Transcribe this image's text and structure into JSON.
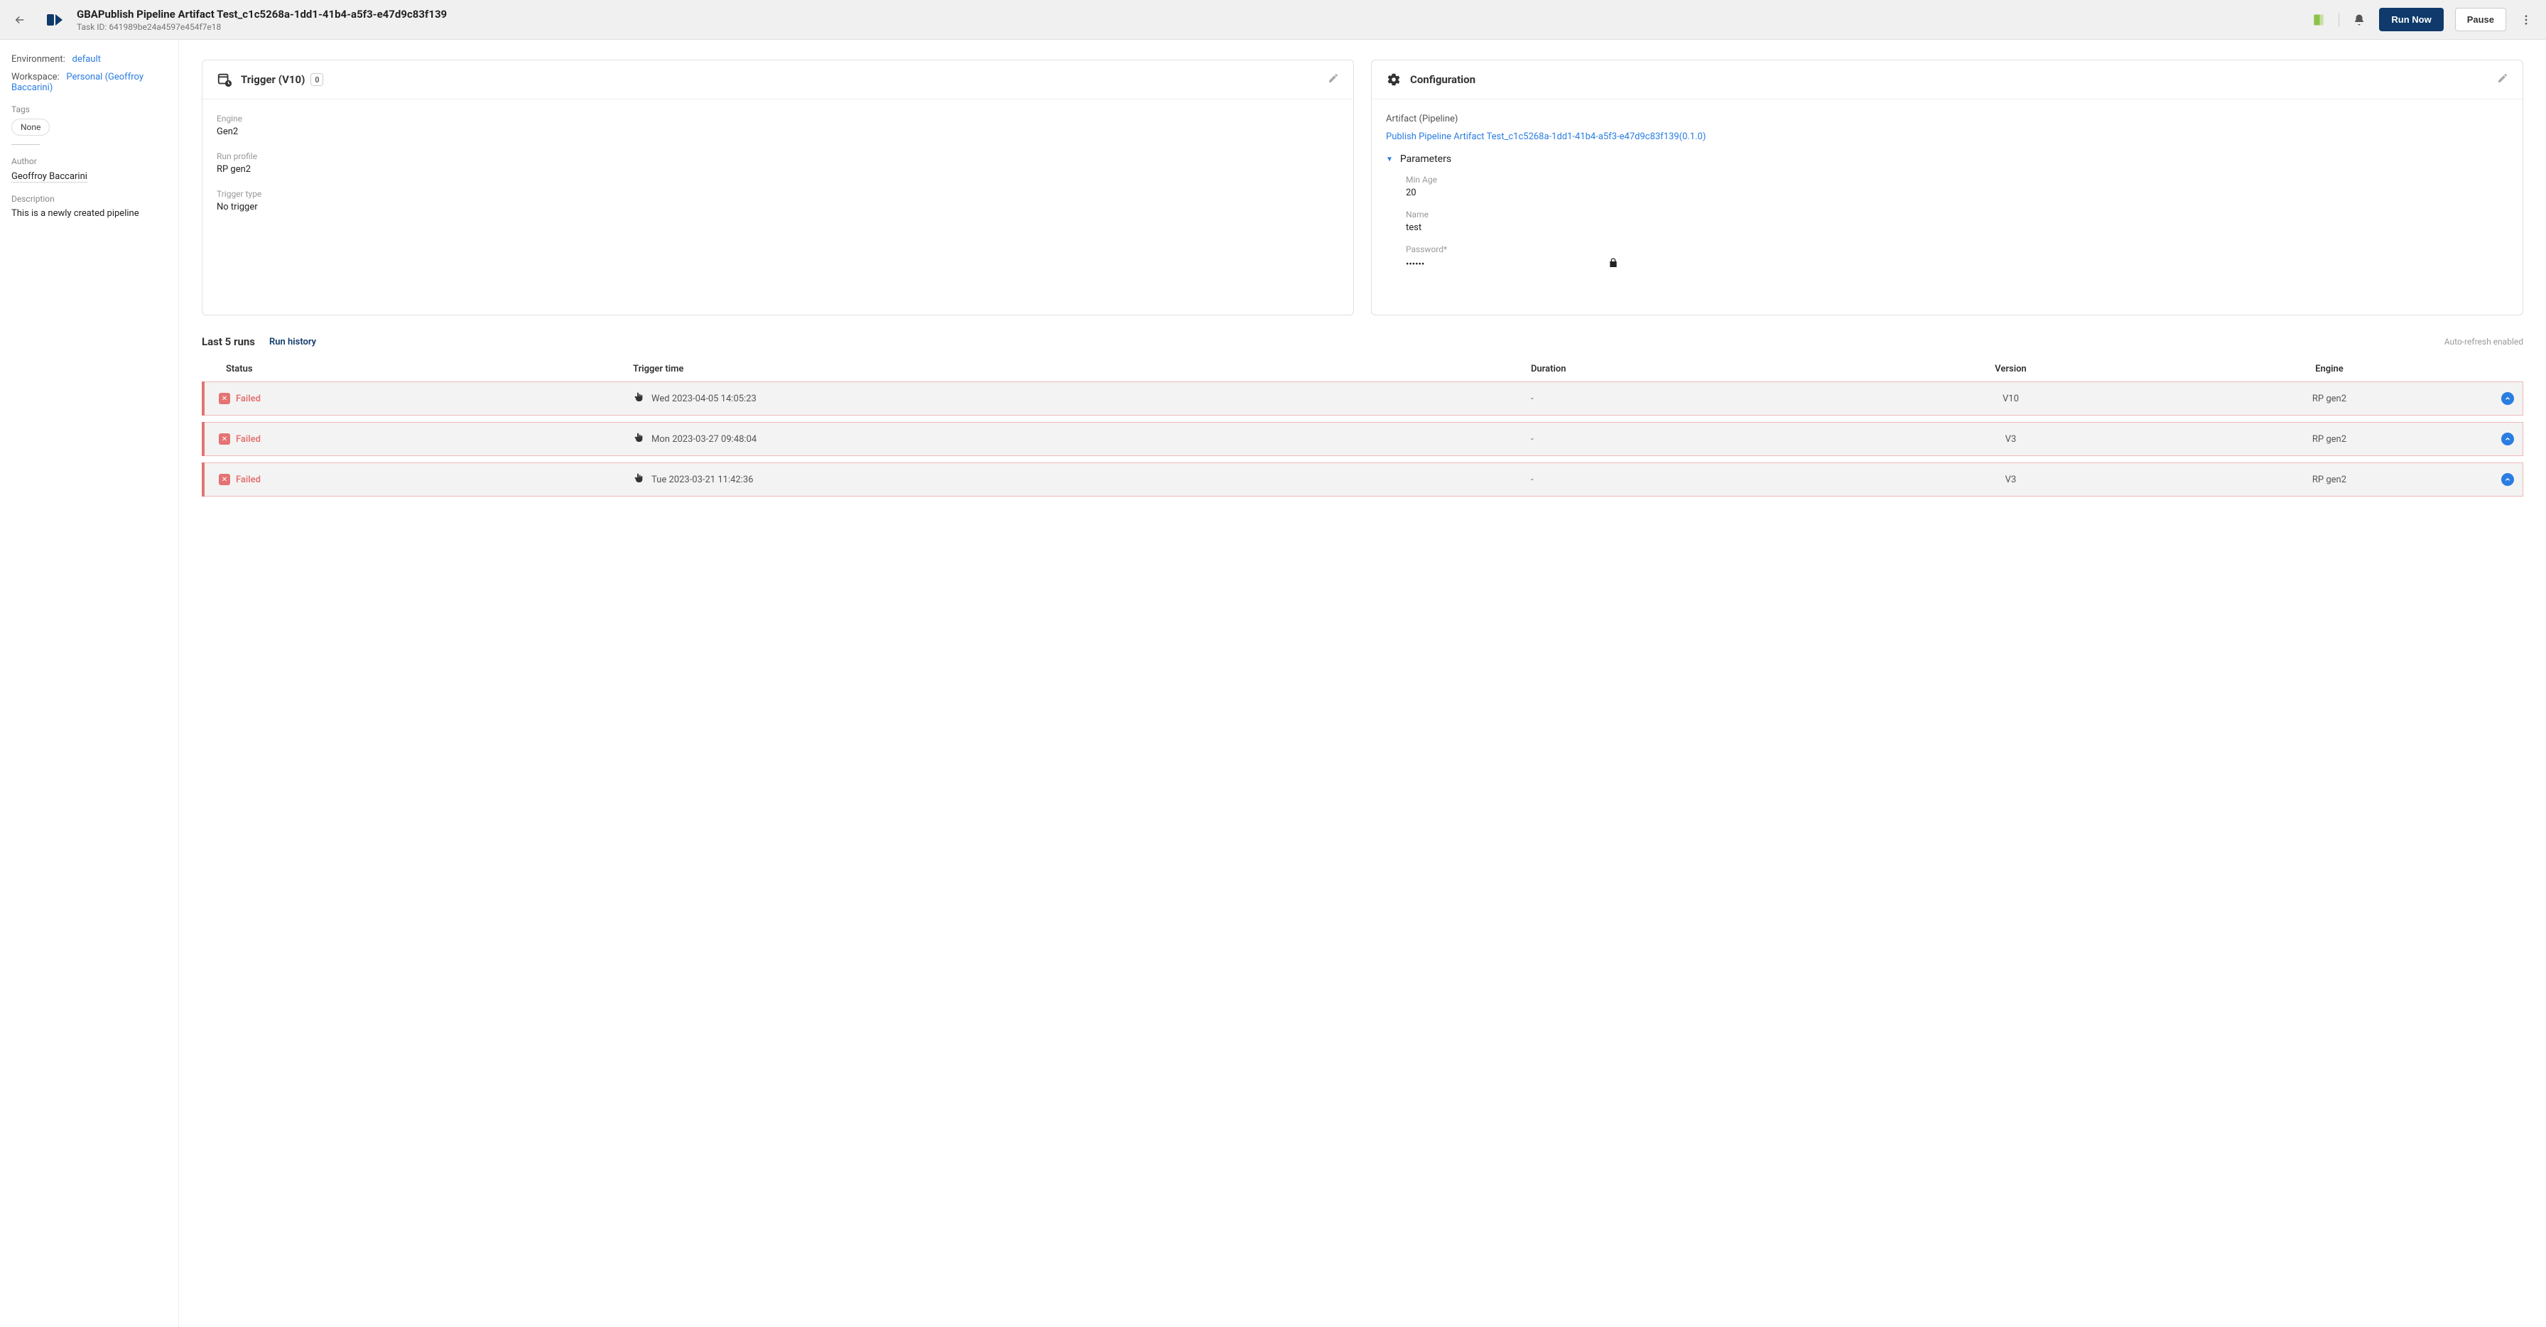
{
  "header": {
    "title": "GBAPublish Pipeline Artifact Test_c1c5268a-1dd1-41b4-a5f3-e47d9c83f139",
    "taskIdLabel": "Task ID:",
    "taskId": "641989be24a4597e454f7e18",
    "runNow": "Run Now",
    "pause": "Pause"
  },
  "sidebar": {
    "envLabel": "Environment:",
    "envValue": "default",
    "wsLabel": "Workspace:",
    "wsValue": "Personal (Geoffroy Baccarini)",
    "tagsLabel": "Tags",
    "tagNone": "None",
    "authorLabel": "Author",
    "authorValue": "Geoffroy Baccarini",
    "descLabel": "Description",
    "descValue": "This is a newly created pipeline"
  },
  "trigger": {
    "title": "Trigger (V10)",
    "badge": "0",
    "engineLabel": "Engine",
    "engineValue": "Gen2",
    "runProfileLabel": "Run profile",
    "runProfileValue": "RP gen2",
    "triggerTypeLabel": "Trigger type",
    "triggerTypeValue": "No trigger"
  },
  "config": {
    "title": "Configuration",
    "artifactLabel": "Artifact (Pipeline)",
    "artifactLink": "Publish Pipeline Artifact Test_c1c5268a-1dd1-41b4-a5f3-e47d9c83f139(0.1.0)",
    "paramsTitle": "Parameters",
    "minAgeLabel": "Min Age",
    "minAgeValue": "20",
    "nameLabel": "Name",
    "nameValue": "test",
    "passwordLabel": "Password*",
    "passwordValue": "••••••"
  },
  "runs": {
    "title": "Last 5 runs",
    "historyLink": "Run history",
    "autoRefresh": "Auto-refresh enabled",
    "columns": {
      "status": "Status",
      "triggerTime": "Trigger time",
      "duration": "Duration",
      "version": "Version",
      "engine": "Engine"
    },
    "items": [
      {
        "status": "Failed",
        "time": "Wed 2023-04-05 14:05:23",
        "duration": "-",
        "version": "V10",
        "engine": "RP gen2"
      },
      {
        "status": "Failed",
        "time": "Mon 2023-03-27 09:48:04",
        "duration": "-",
        "version": "V3",
        "engine": "RP gen2"
      },
      {
        "status": "Failed",
        "time": "Tue 2023-03-21 11:42:36",
        "duration": "-",
        "version": "V3",
        "engine": "RP gen2"
      }
    ]
  }
}
